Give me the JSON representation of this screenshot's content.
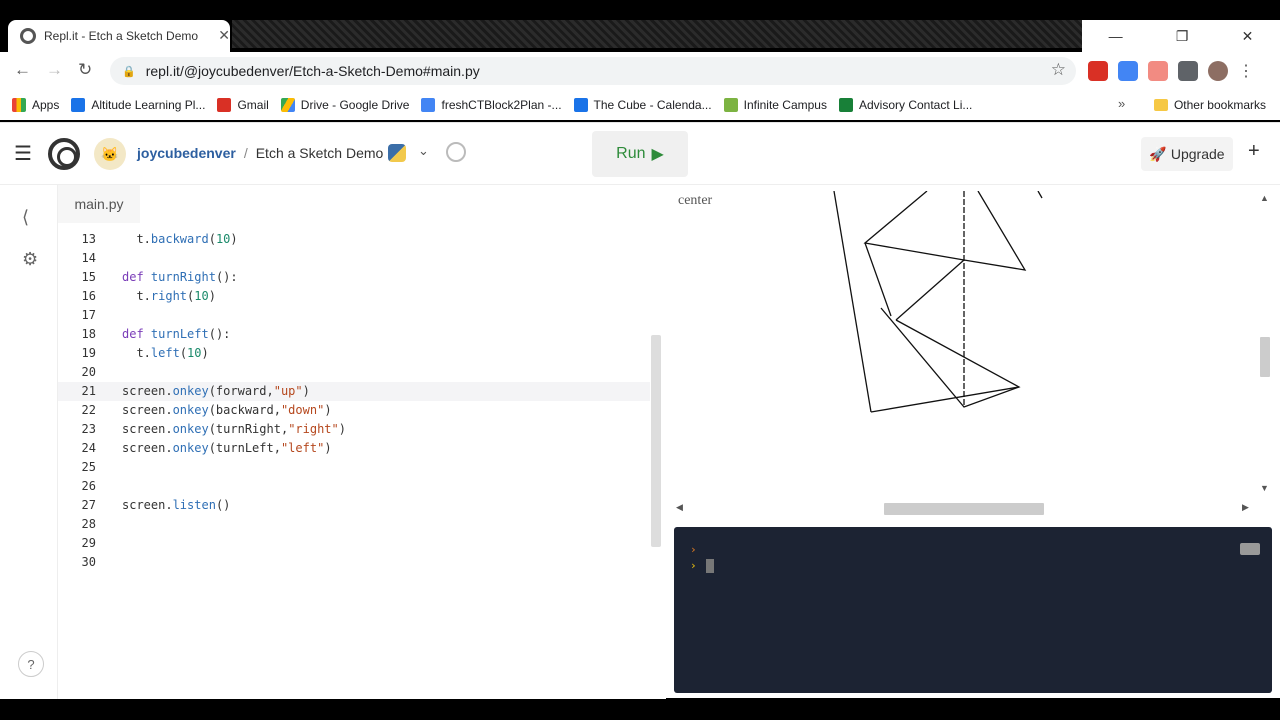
{
  "browser": {
    "tab_title": "Repl.it - Etch a Sketch Demo",
    "url": "repl.it/@joycubedenver/Etch-a-Sketch-Demo#main.py",
    "bookmarks": [
      {
        "label": "Apps",
        "color": "#4285f4"
      },
      {
        "label": "Altitude Learning Pl...",
        "color": "#1a73e8"
      },
      {
        "label": "Gmail",
        "color": "#d93025"
      },
      {
        "label": "Drive - Google Drive",
        "color": "#34a853"
      },
      {
        "label": "freshCTBlock2Plan -...",
        "color": "#4285f4"
      },
      {
        "label": "The Cube - Calenda...",
        "color": "#1a73e8"
      },
      {
        "label": "Infinite Campus",
        "color": "#7cb342"
      },
      {
        "label": "Advisory Contact Li...",
        "color": "#188038"
      }
    ],
    "other_bookmarks": "Other bookmarks"
  },
  "header": {
    "username": "joycubedenver",
    "separator": "/",
    "repl_name": "Etch a Sketch Demo",
    "run_label": "Run",
    "upgrade_label": "Upgrade"
  },
  "editor": {
    "file_tab": "main.py",
    "active_line": 21
  },
  "output": {
    "canvas_label": "center"
  },
  "colors": {
    "run_green": "#2e8b3a",
    "console_bg": "#1c2333",
    "prompt_orange": "#e67e22",
    "prompt_yellow": "#f1c40f"
  }
}
